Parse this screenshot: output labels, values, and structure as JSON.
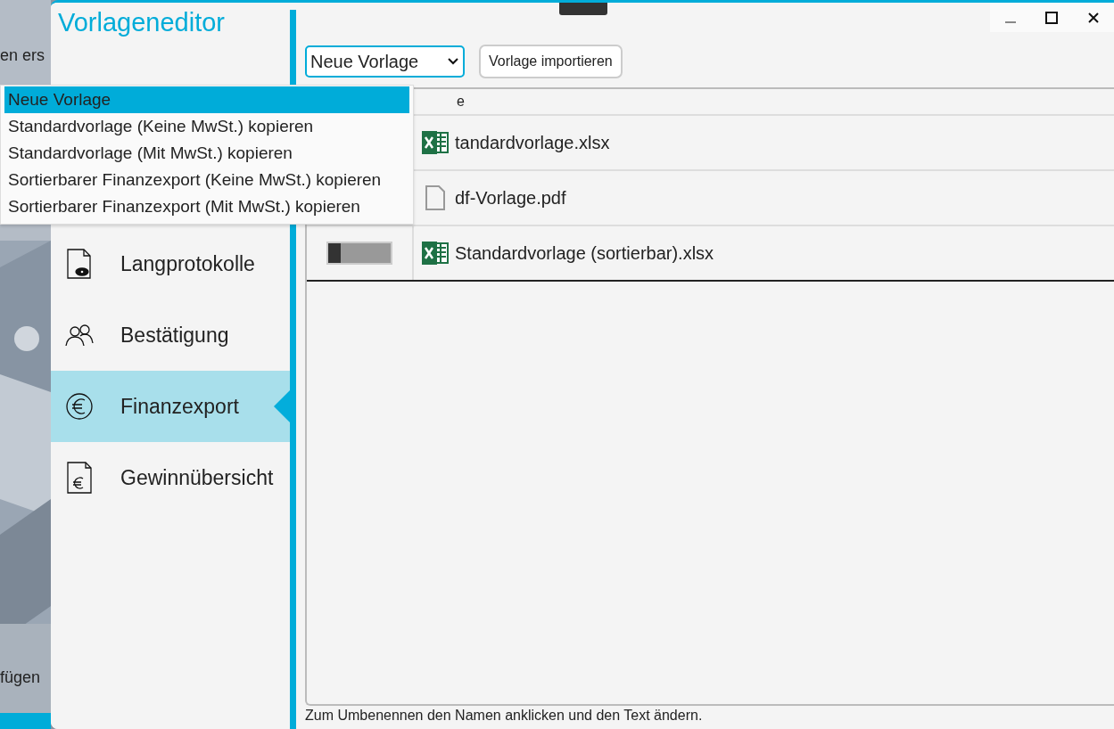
{
  "background_app": {
    "texts": [
      "en ers",
      "fügen"
    ]
  },
  "window": {
    "title": "Vorlageneditor"
  },
  "sidebar": {
    "items": [
      {
        "label": "Langprotokolle",
        "kind": "preview",
        "selected": false
      },
      {
        "label": "Bestätigung",
        "kind": "people",
        "selected": false
      },
      {
        "label": "Finanzexport",
        "kind": "money",
        "selected": true
      },
      {
        "label": "Gewinnübersicht",
        "kind": "report",
        "selected": false
      }
    ]
  },
  "toolbar": {
    "template_select": {
      "value": "Neue Vorlage",
      "expanded": true
    },
    "import_button": "Vorlage importieren"
  },
  "dropdown": {
    "options": [
      {
        "label": "Neue Vorlage",
        "selected": true
      },
      {
        "label": "Standardvorlage (Keine MwSt.) kopieren",
        "selected": false
      },
      {
        "label": "Standardvorlage (Mit MwSt.) kopieren",
        "selected": false
      },
      {
        "label": "Sortierbarer Finanzexport (Keine MwSt.) kopieren",
        "selected": false
      },
      {
        "label": "Sortierbarer Finanzexport (Mit MwSt.) kopieren",
        "selected": false
      }
    ]
  },
  "table": {
    "header": "e",
    "rows": [
      {
        "name": "tandardvorlage.xlsx",
        "kind": "sheet"
      },
      {
        "name": "df-Vorlage.pdf",
        "kind": "document"
      },
      {
        "name": "Standardvorlage (sortierbar).xlsx",
        "kind": "sheet",
        "on": false
      }
    ]
  },
  "status_bar": "Zum Umbenennen den Namen anklicken und den Text ändern."
}
